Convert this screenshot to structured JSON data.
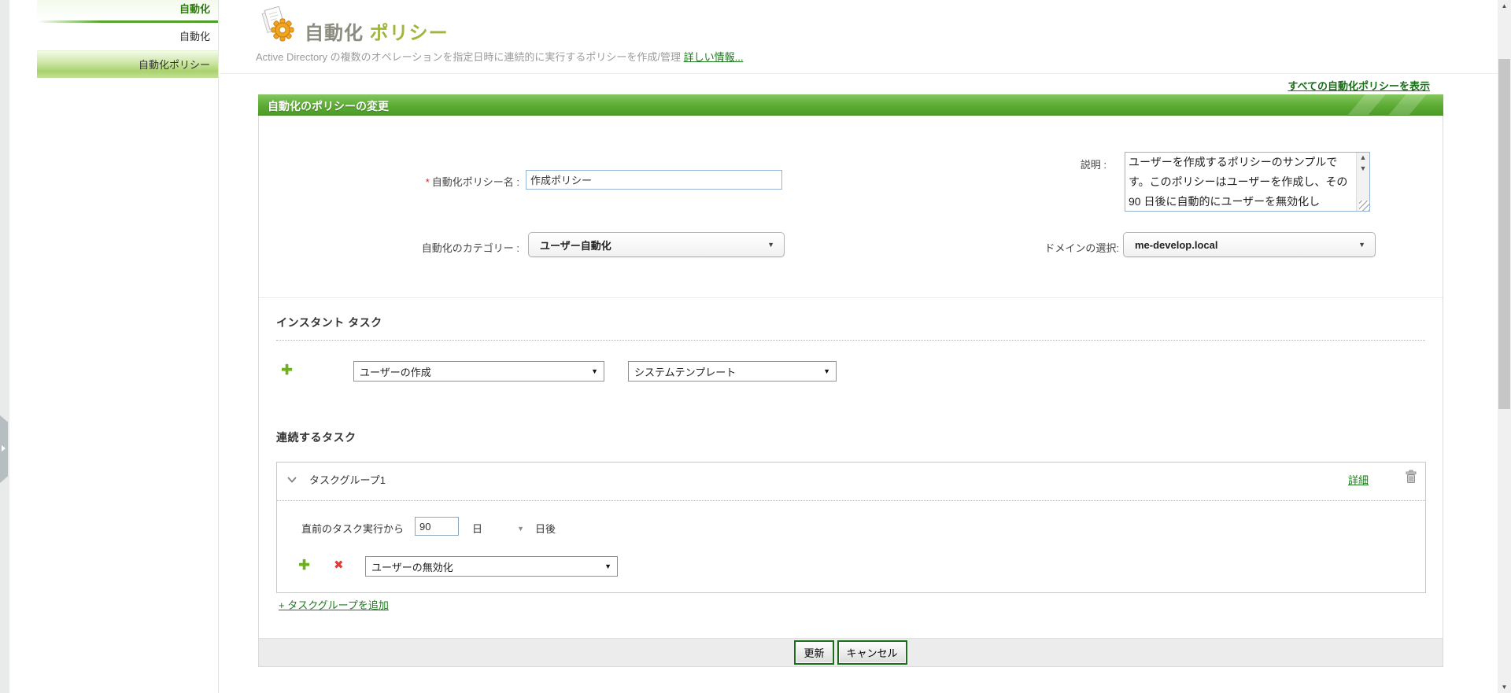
{
  "colors": {
    "accent_green": "#5cab33",
    "link_green": "#1d7a1d",
    "selected_item_green": "#a9d26e",
    "title_green": "#9fb63c",
    "required_red": "#e02020",
    "remove_red": "#e23b35",
    "add_green": "#6fae1f"
  },
  "icons": {
    "header": "automation-gear-papers-icon",
    "add": "plus-icon",
    "remove": "x-icon",
    "delete": "trash-icon",
    "collapse_group": "chevron-down-icon",
    "dropdown": "caret-down-icon",
    "sidebar_toggle": "arrow-right-icon"
  },
  "sidebar": {
    "header": "自動化",
    "items": [
      {
        "label": "自動化",
        "selected": false
      },
      {
        "label": "自動化ポリシー",
        "selected": true
      }
    ]
  },
  "header": {
    "title_gray": "自動化",
    "title_green": "ポリシー",
    "subtitle": "Active Directory の複数のオペレーションを指定日時に連続的に実行するポリシーを作成/管理",
    "more_info_link": "詳しい情報...",
    "view_all_link": "すべての自動化ポリシーを表示"
  },
  "panel": {
    "title": "自動化のポリシーの変更"
  },
  "form": {
    "policy_name": {
      "required_mark": "*",
      "label": "自動化ポリシー名 :",
      "value": "作成ポリシー"
    },
    "description": {
      "label": "説明 :",
      "value": "ユーザーを作成するポリシーのサンプルです。このポリシーはユーザーを作成し、その 90 日後に自動的にユーザーを無効化し"
    },
    "category": {
      "label": "自動化のカテゴリー :",
      "value": "ユーザー自動化"
    },
    "domain": {
      "label": "ドメインの選択:",
      "value": "me-develop.local"
    }
  },
  "instant_task": {
    "heading": "インスタント タスク",
    "task_select": "ユーザーの作成",
    "template_select": "システムテンプレート"
  },
  "sequential_task": {
    "heading": "連続するタスク",
    "group": {
      "title": "タスクグループ1",
      "details_link": "詳細",
      "interval_prefix": "直前のタスク実行から",
      "interval_value": "90",
      "interval_unit": "日",
      "interval_suffix": "日後",
      "task_select": "ユーザーの無効化"
    },
    "add_group_link": "+ タスクグループを追加"
  },
  "footer": {
    "update_button": "更新",
    "cancel_button": "キャンセル"
  }
}
